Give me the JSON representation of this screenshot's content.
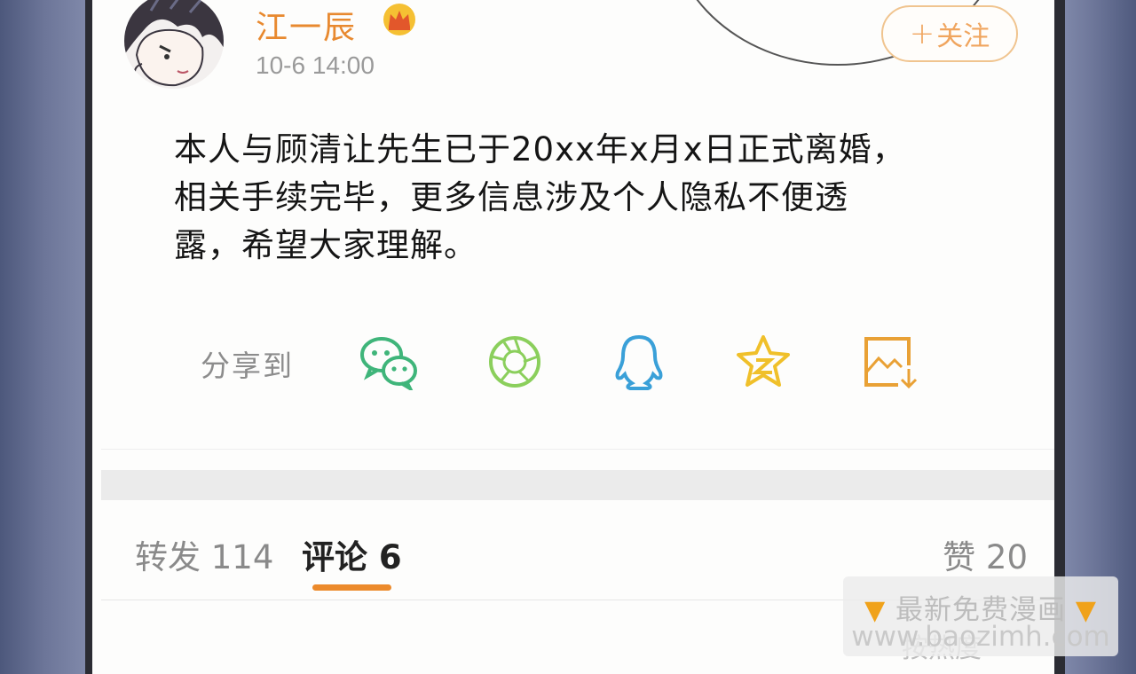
{
  "post": {
    "username": "江一辰",
    "timestamp": "10-6 14:00",
    "follow_label": "关注",
    "follow_plus": "+",
    "body_lines": [
      "本人与顾清让先生已于20xx年x月x日正式离婚，",
      "相关手续完毕，更多信息涉及个人隐私不便透",
      "露，希望大家理解。"
    ]
  },
  "share": {
    "label": "分享到",
    "icons": [
      "wechat-icon",
      "moments-icon",
      "qq-icon",
      "qzone-icon",
      "save-image-icon"
    ]
  },
  "tabs": {
    "repost_label": "转发",
    "repost_count": "114",
    "comments_label": "评论",
    "comments_count": "6",
    "likes_label": "赞",
    "likes_count": "20"
  },
  "sort_label": "按热度",
  "watermark": {
    "line1": "最新免费漫画",
    "line2": "www.baozimh.com"
  },
  "colors": {
    "accent": "#ec8a2b",
    "username": "#e8892f",
    "wechat": "#3fb57a",
    "moments": "#8bcf5c",
    "qq": "#3aa0d8",
    "qzone": "#f0c02a",
    "save": "#e9a135"
  }
}
